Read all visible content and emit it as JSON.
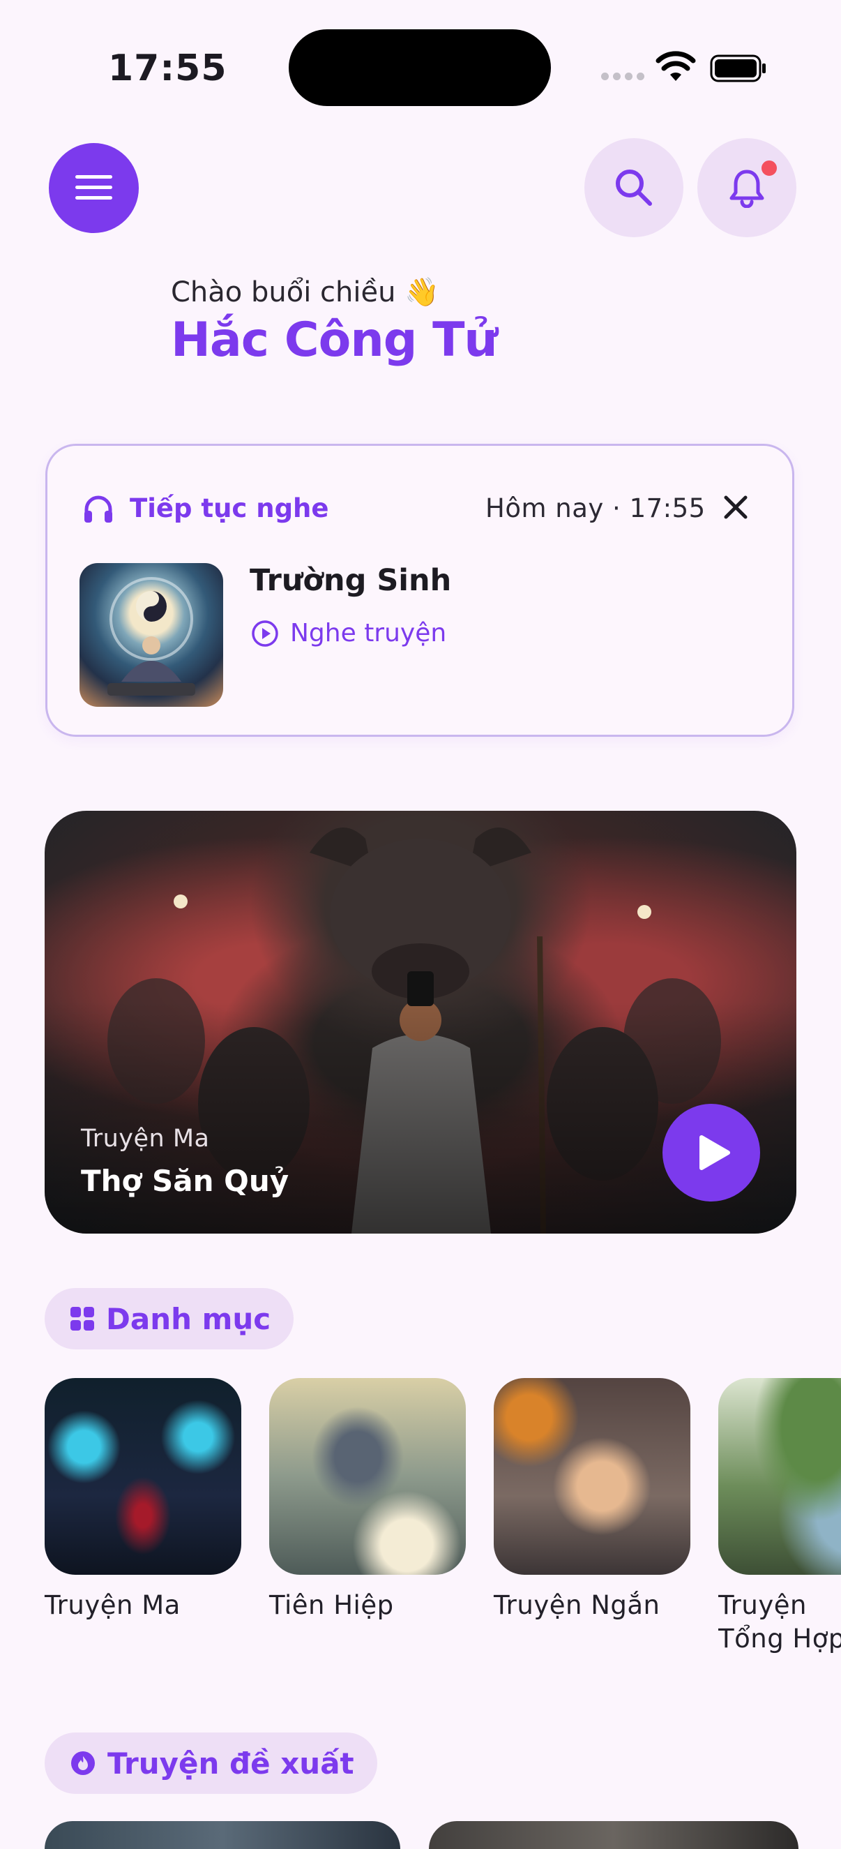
{
  "status_bar": {
    "time": "17:55"
  },
  "header": {
    "menu_icon": "hamburger-menu-icon",
    "search_icon": "search-icon",
    "notification_icon": "bell-icon",
    "has_notification": true
  },
  "greeting": {
    "text": "Chào buổi chiều 👋",
    "name": "Hắc Công Tử"
  },
  "continue_listening": {
    "title": "Tiếp tục nghe",
    "timestamp": "Hôm nay · 17:55",
    "book_title": "Trường Sinh",
    "action_label": "Nghe truyện"
  },
  "featured": {
    "category": "Truyện Ma",
    "title": "Thợ Săn Quỷ"
  },
  "categories": {
    "title": "Danh mục",
    "items": [
      {
        "label": "Truyện Ma"
      },
      {
        "label": "Tiên Hiệp"
      },
      {
        "label": "Truyện Ngắn"
      },
      {
        "label": "Truyện Tổng Hợp"
      }
    ]
  },
  "recommended": {
    "title": "Truyện đề xuất"
  },
  "colors": {
    "accent": "#7c3aed",
    "chip_bg": "#eedff6",
    "background": "#fcf5fd",
    "notification_dot": "#f4505e"
  }
}
